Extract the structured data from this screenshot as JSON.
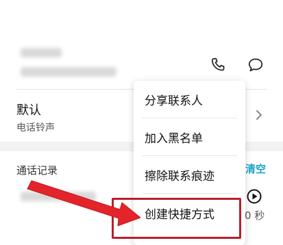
{
  "ringtone": {
    "title": "默认",
    "subtitle": "电话铃声"
  },
  "call_log": {
    "label": "通话记录",
    "clear_label": "清空",
    "duration_fragment": "0 秒"
  },
  "menu": {
    "items": [
      {
        "label": "分享联系人"
      },
      {
        "label": "加入黑名单"
      },
      {
        "label": "擦除联系痕迹"
      },
      {
        "label": "创建快捷方式"
      }
    ]
  },
  "icons": {
    "call": "phone-icon",
    "message": "message-bubble-icon",
    "chevron": "chevron-right-icon",
    "play": "play-circle-icon"
  },
  "colors": {
    "highlight_box": "#b81f2a",
    "arrow": "#e3242b",
    "clear_link": "#1aa3c9"
  }
}
